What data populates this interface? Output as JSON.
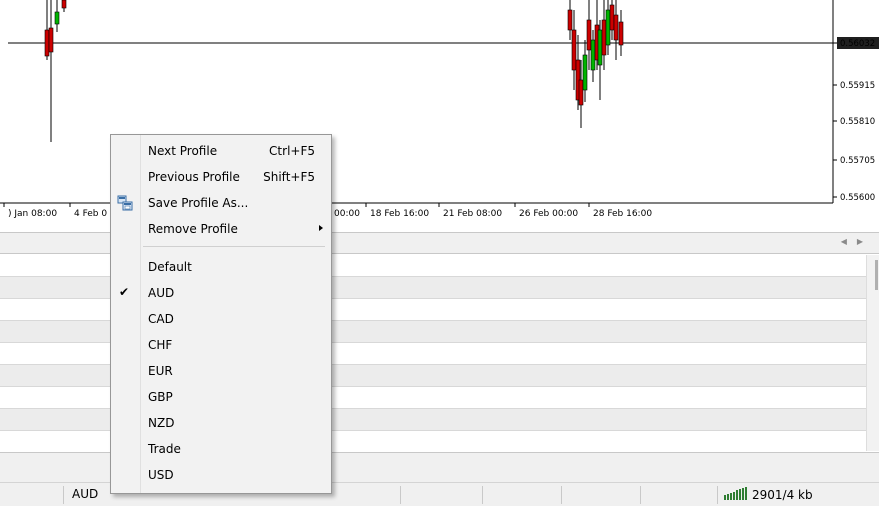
{
  "chart": {
    "price_labels": [
      "0.56032",
      "0.55915",
      "0.55810",
      "0.55705",
      "0.55600"
    ],
    "time_labels": [
      ") Jan 08:00",
      "4 Feb 0",
      "00:00",
      "18 Feb 16:00",
      "21 Feb 08:00",
      "26 Feb 00:00",
      "28 Feb 16:00"
    ],
    "colors": {
      "bull": "#00b400",
      "bear": "#cc0000",
      "wick": "#000000",
      "price_tag_bg": "#1f1f1f",
      "price_tag_fg": "#ffffff"
    }
  },
  "context_menu": {
    "items": [
      {
        "label": "Next Profile",
        "shortcut": "Ctrl+F5"
      },
      {
        "label": "Previous Profile",
        "shortcut": "Shift+F5"
      },
      {
        "label": "Save Profile As...",
        "icon": "save-profile-icon"
      },
      {
        "label": "Remove Profile",
        "submenu": true
      }
    ],
    "profiles": [
      "Default",
      "AUD",
      "CAD",
      "CHF",
      "EUR",
      "GBP",
      "NZD",
      "Trade",
      "USD"
    ],
    "checked_profile": "AUD"
  },
  "status_bar": {
    "profile": "AUD",
    "traffic": "2901/4 kb",
    "traffic_icon": "connection-bars-icon"
  },
  "tab_strip": {
    "arrows_icon": "scroll-arrows-icon"
  }
}
